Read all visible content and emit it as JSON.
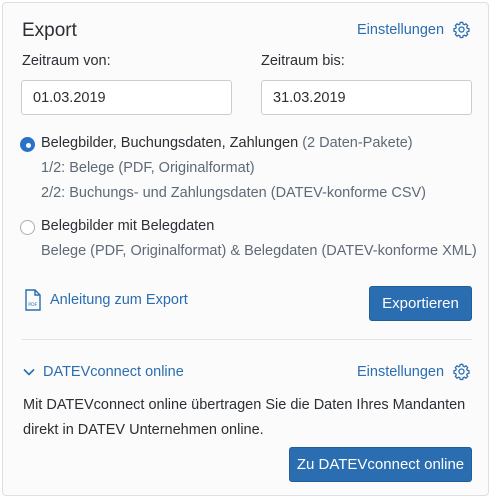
{
  "export": {
    "title": "Export",
    "settings_label": "Einstellungen",
    "from_label": "Zeitraum von:",
    "to_label": "Zeitraum bis:",
    "from_value": "01.03.2019",
    "to_value": "31.03.2019",
    "options": [
      {
        "label": "Belegbilder, Buchungsdaten, Zahlungen",
        "note": "(2 Daten-Pakete)",
        "selected": true,
        "details": [
          "1/2: Belege (PDF, Originalformat)",
          "2/2: Buchungs- und Zahlungsdaten (DATEV-konforme CSV)"
        ]
      },
      {
        "label": "Belegbilder mit Belegdaten",
        "selected": false,
        "details": [
          "Belege (PDF, Originalformat) & Belegdaten (DATEV-konforme XML)"
        ]
      }
    ],
    "guide_link": "Anleitung zum Export",
    "export_button": "Exportieren"
  },
  "datev": {
    "section_label": "DATEVconnect online",
    "settings_label": "Einstellungen",
    "description": "Mit DATEVconnect online übertragen Sie die Daten Ihres Mandanten direkt in DATEV Unternehmen online.",
    "button_label": "Zu DATEVconnect online"
  },
  "colors": {
    "accent": "#2a6db0",
    "radio_selected": "#2a72c8",
    "text": "#2b2f33",
    "muted": "#5e6a76"
  }
}
